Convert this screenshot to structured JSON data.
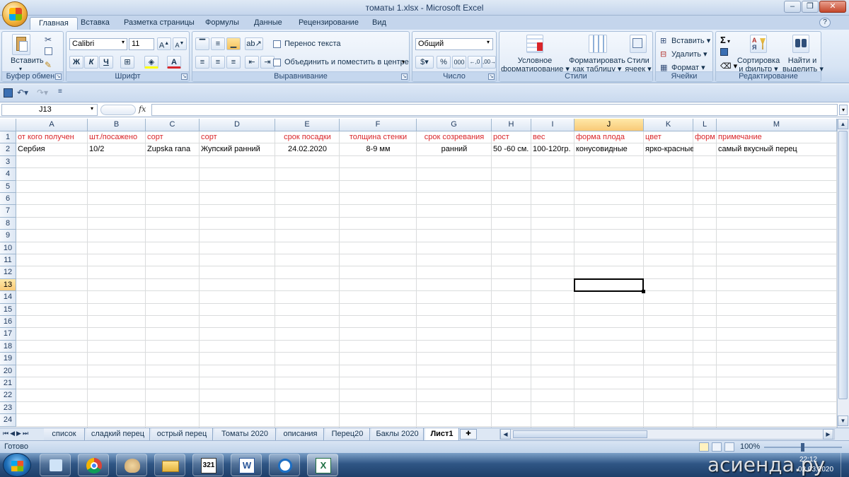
{
  "window": {
    "title": "томаты 1.xlsx - Microsoft Excel"
  },
  "tabs": [
    "Главная",
    "Вставка",
    "Разметка страницы",
    "Формулы",
    "Данные",
    "Рецензирование",
    "Вид"
  ],
  "ribbon": {
    "clipboard": {
      "label": "Буфер обмена",
      "paste": "Вставить"
    },
    "font": {
      "label": "Шрифт",
      "name": "Calibri",
      "size": "11",
      "bold": "Ж",
      "italic": "К",
      "underline": "Ч"
    },
    "alignment": {
      "label": "Выравнивание",
      "wrap": "Перенос текста",
      "merge": "Объединить и поместить в центре"
    },
    "number": {
      "label": "Число",
      "format": "Общий",
      "percent": "%",
      "thousands": "000"
    },
    "styles": {
      "label": "Стили",
      "cond1": "Условное",
      "cond2": "форматирование",
      "table1": "Форматировать",
      "table2": "как таблицу",
      "cell1": "Стили",
      "cell2": "ячеек"
    },
    "cells": {
      "label": "Ячейки",
      "insert": "Вставить",
      "delete": "Удалить",
      "format": "Формат"
    },
    "editing": {
      "label": "Редактирование",
      "sort1": "Сортировка",
      "sort2": "и фильтр",
      "find1": "Найти и",
      "find2": "выделить",
      "sum": "Σ"
    }
  },
  "formula_bar": {
    "name_box": "J13",
    "fx": "fx",
    "formula": ""
  },
  "columns": [
    "A",
    "B",
    "C",
    "D",
    "E",
    "F",
    "G",
    "H",
    "I",
    "J",
    "K",
    "L",
    "M"
  ],
  "rows": [
    "1",
    "2",
    "3",
    "4",
    "5",
    "6",
    "7",
    "8",
    "9",
    "10",
    "11",
    "12",
    "13",
    "14",
    "15",
    "16",
    "17",
    "18",
    "19",
    "20",
    "21",
    "22",
    "23",
    "24"
  ],
  "header_row": [
    "от кого получен",
    "шт./посажено",
    "сорт",
    "сорт",
    "срок посадки",
    "толщина стенки",
    "срок созревания",
    "рост",
    "вес",
    "форма плода",
    "цвет",
    "форм",
    "примечание"
  ],
  "data_row": [
    "Сербия",
    "10/2",
    "Zupska rana",
    "Жупский ранний",
    "24.02.2020",
    "8-9 мм",
    "ранний",
    "50 -60 см.",
    "100-120гр.",
    "конусовидные",
    "ярко-красные",
    "",
    "самый вкусный перец"
  ],
  "sheets": [
    "список",
    "сладкий перец",
    "острый перец",
    "Томаты 2020",
    "описания",
    "Перец20",
    "Баклы 2020",
    "Лист1"
  ],
  "active_sheet": "Лист1",
  "status": {
    "ready": "Готово",
    "zoom": "100%"
  },
  "watermark": "асиенда.ру",
  "clock": {
    "time": "22:12",
    "date": "02.03.2020"
  },
  "accent_red": "#d9262a"
}
